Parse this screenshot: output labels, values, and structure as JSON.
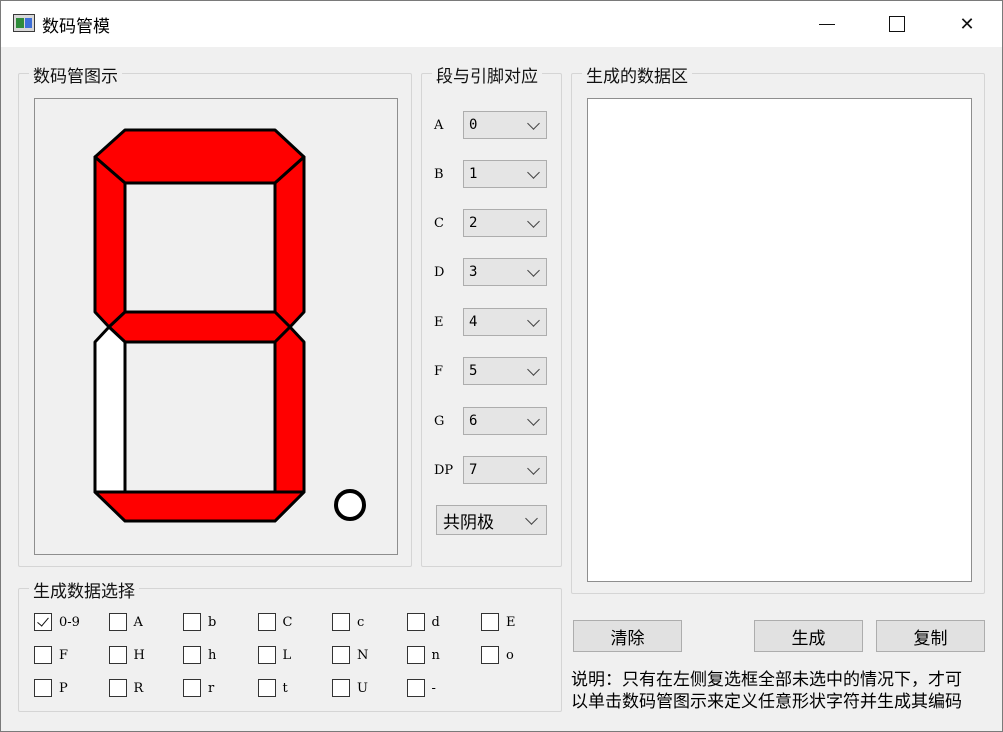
{
  "window": {
    "title": "数码管模",
    "icon": "app-window-icon"
  },
  "titlebar_buttons": {
    "minimize": "minimize-icon",
    "maximize": "maximize-icon",
    "close_glyph": "✕"
  },
  "display": {
    "title": "数码管图示",
    "segments": {
      "a": "on",
      "b": "on",
      "c": "on",
      "d": "on",
      "e": "off",
      "f": "on",
      "g": "on",
      "dp": "off"
    },
    "colors": {
      "on": "#ff0000",
      "off": "#ffffff",
      "stroke": "#000000"
    }
  },
  "segmap": {
    "title": "段与引脚对应",
    "rows": [
      {
        "label": "A",
        "value": "0"
      },
      {
        "label": "B",
        "value": "1"
      },
      {
        "label": "C",
        "value": "2"
      },
      {
        "label": "D",
        "value": "3"
      },
      {
        "label": "E",
        "value": "4"
      },
      {
        "label": "F",
        "value": "5"
      },
      {
        "label": "G",
        "value": "6"
      },
      {
        "label": "DP",
        "value": "7"
      }
    ],
    "mode": "共阴极"
  },
  "data_area": {
    "title": "生成的数据区",
    "content": ""
  },
  "select": {
    "title": "生成数据选择",
    "items": [
      {
        "label": "0-9",
        "checked": true
      },
      {
        "label": "A",
        "checked": false
      },
      {
        "label": "b",
        "checked": false
      },
      {
        "label": "C",
        "checked": false
      },
      {
        "label": "c",
        "checked": false
      },
      {
        "label": "d",
        "checked": false
      },
      {
        "label": "E",
        "checked": false
      },
      {
        "label": "F",
        "checked": false
      },
      {
        "label": "H",
        "checked": false
      },
      {
        "label": "h",
        "checked": false
      },
      {
        "label": "L",
        "checked": false
      },
      {
        "label": "N",
        "checked": false
      },
      {
        "label": "n",
        "checked": false
      },
      {
        "label": "o",
        "checked": false
      },
      {
        "label": "P",
        "checked": false
      },
      {
        "label": "R",
        "checked": false
      },
      {
        "label": "r",
        "checked": false
      },
      {
        "label": "t",
        "checked": false
      },
      {
        "label": "U",
        "checked": false
      },
      {
        "label": "-",
        "checked": false
      }
    ]
  },
  "buttons": {
    "clear": "清除",
    "generate": "生成",
    "copy": "复制"
  },
  "note": {
    "line1": "说明：只有在左侧复选框全部未选中的情况下，才可",
    "line2": "以单击数码管图示来定义任意形状字符并生成其编码"
  }
}
